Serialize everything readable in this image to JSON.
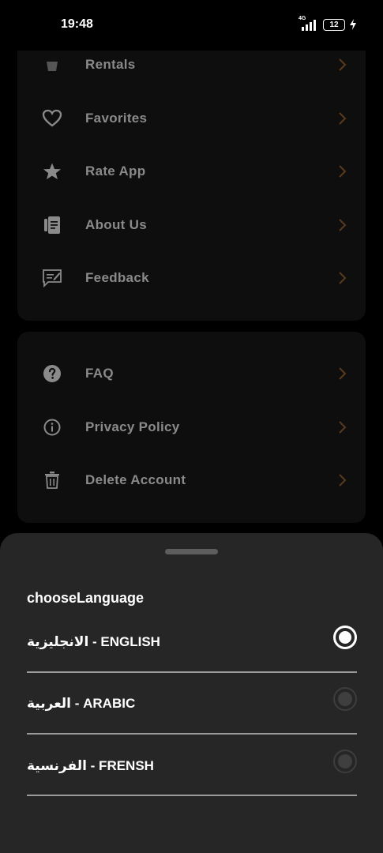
{
  "status_bar": {
    "time": "19:48",
    "network": "4G",
    "battery": "12"
  },
  "menu_card_1": {
    "items": [
      {
        "label": "Rentals",
        "icon": "bag-icon"
      },
      {
        "label": "Favorites",
        "icon": "heart-icon"
      },
      {
        "label": "Rate App",
        "icon": "star-icon"
      },
      {
        "label": "About Us",
        "icon": "document-icon"
      },
      {
        "label": "Feedback",
        "icon": "feedback-icon"
      }
    ]
  },
  "menu_card_2": {
    "items": [
      {
        "label": "FAQ",
        "icon": "question-icon"
      },
      {
        "label": "Privacy Policy",
        "icon": "info-icon"
      },
      {
        "label": "Delete Account",
        "icon": "trash-icon"
      }
    ]
  },
  "language_sheet": {
    "title": "chooseLanguage",
    "options": [
      {
        "label": "الانجليزية - ENGLISH",
        "selected": true
      },
      {
        "label": "العربية - ARABIC",
        "selected": false
      },
      {
        "label": "الفرنسية - FRENSH",
        "selected": false
      }
    ]
  },
  "colors": {
    "chevron": "#5a3a1c",
    "sheet_bg": "#262626",
    "card_bg": "#0e0e0e"
  }
}
